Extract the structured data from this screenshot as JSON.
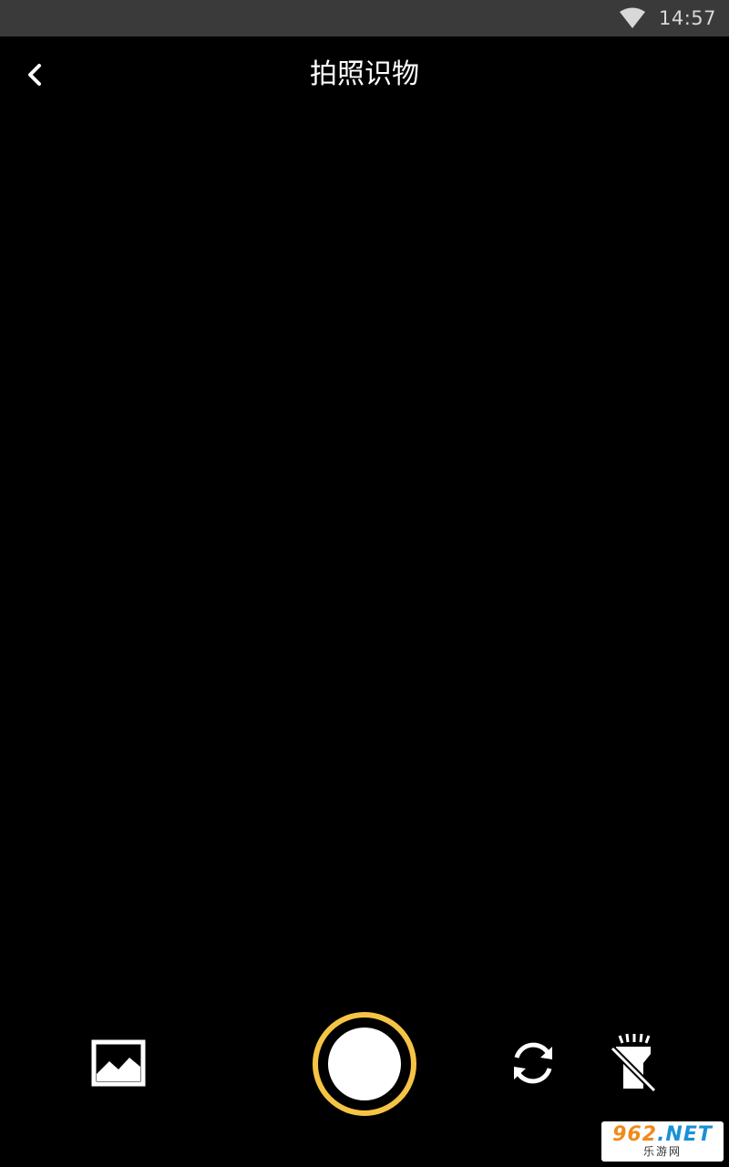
{
  "status_bar": {
    "time": "14:57",
    "icons": [
      "wifi-icon"
    ]
  },
  "header": {
    "title": "拍照识物",
    "back_icon": "chevron-left-icon"
  },
  "controls": {
    "gallery_icon": "image-icon",
    "shutter_icon": "shutter-icon",
    "switch_icon": "camera-switch-icon",
    "flash_icon": "flashlight-off-icon"
  },
  "watermark": {
    "logo_number": "962",
    "logo_text": ".NET",
    "subtitle": "乐游网"
  },
  "colors": {
    "background": "#000000",
    "status_bar": "#3a3a3a",
    "shutter_ring": "#f6c445",
    "icon": "#ffffff"
  }
}
